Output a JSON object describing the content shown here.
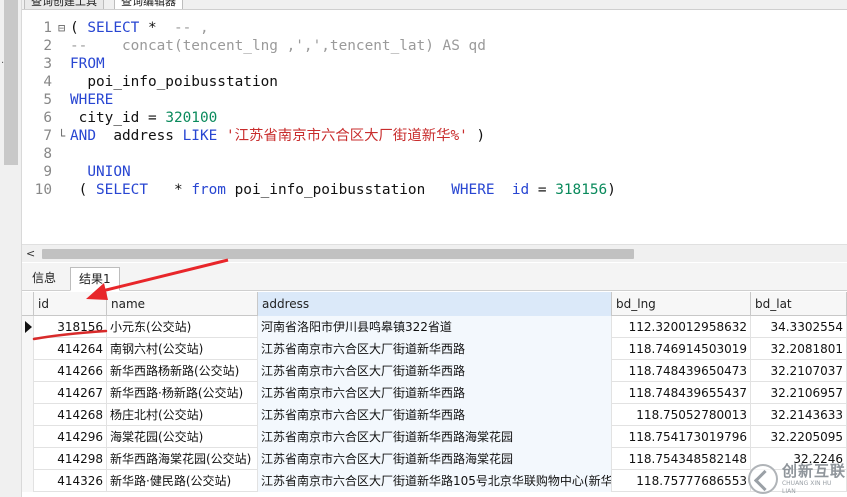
{
  "tabs": [
    "查询创建工具",
    "查询编辑器"
  ],
  "editor": {
    "lines": [
      {
        "n": "1",
        "fold": "⊟",
        "tokens": [
          [
            "txt",
            "( "
          ],
          [
            "kw",
            "SELECT"
          ],
          [
            "txt",
            " * "
          ],
          [
            "cmt",
            " -- ,"
          ]
        ]
      },
      {
        "n": "2",
        "fold": "",
        "tokens": [
          [
            "cmt",
            "--    concat(tencent_lng ,',',tencent_lat) AS qd"
          ]
        ]
      },
      {
        "n": "3",
        "fold": "",
        "tokens": [
          [
            "kw",
            "FROM"
          ]
        ]
      },
      {
        "n": "4",
        "fold": "",
        "tokens": [
          [
            "txt",
            "  poi_info_poibusstation"
          ]
        ]
      },
      {
        "n": "5",
        "fold": "",
        "tokens": [
          [
            "kw",
            "WHERE"
          ]
        ]
      },
      {
        "n": "6",
        "fold": "",
        "tokens": [
          [
            "txt",
            " city_id = "
          ],
          [
            "num",
            "320100"
          ]
        ]
      },
      {
        "n": "7",
        "fold": "└",
        "tokens": [
          [
            "kw",
            "AND"
          ],
          [
            "txt",
            "  address "
          ],
          [
            "kw",
            "LIKE"
          ],
          [
            "txt",
            " "
          ],
          [
            "str",
            "'江苏省南京市六合区大厂街道新华%'"
          ],
          [
            "txt",
            " )"
          ]
        ]
      },
      {
        "n": "8",
        "fold": "",
        "tokens": []
      },
      {
        "n": "9",
        "fold": "",
        "tokens": [
          [
            "txt",
            "  "
          ],
          [
            "kw",
            "UNION"
          ]
        ]
      },
      {
        "n": "10",
        "fold": "",
        "tokens": [
          [
            "txt",
            " ( "
          ],
          [
            "kw",
            "SELECT"
          ],
          [
            "txt",
            "   * "
          ],
          [
            "kw",
            "from"
          ],
          [
            "txt",
            " poi_info_poibusstation   "
          ],
          [
            "kw",
            "WHERE"
          ],
          [
            "txt",
            "  "
          ],
          [
            "kw",
            "id"
          ],
          [
            "txt",
            " = "
          ],
          [
            "num",
            "318156"
          ],
          [
            "txt",
            ")"
          ]
        ]
      }
    ]
  },
  "result_tabs": {
    "info": "信息",
    "result1": "结果1"
  },
  "grid": {
    "columns": [
      "id",
      "name",
      "address",
      "bd_lng",
      "bd_lat"
    ],
    "rows": [
      [
        "318156",
        "小元东(公交站)",
        "河南省洛阳市伊川县鸣皋镇322省道",
        "112.320012958632",
        "34.3302554"
      ],
      [
        "414264",
        "南钢六村(公交站)",
        "江苏省南京市六合区大厂街道新华西路",
        "118.746914503019",
        "32.2081801"
      ],
      [
        "414266",
        "新华西路杨新路(公交站)",
        "江苏省南京市六合区大厂街道新华西路",
        "118.748439650473",
        "32.2107037"
      ],
      [
        "414267",
        "新华西路·杨新路(公交站)",
        "江苏省南京市六合区大厂街道新华西路",
        "118.748439655437",
        "32.2106957"
      ],
      [
        "414268",
        "杨庄北村(公交站)",
        "江苏省南京市六合区大厂街道新华西路",
        "118.75052780013",
        "32.2143633"
      ],
      [
        "414296",
        "海棠花园(公交站)",
        "江苏省南京市六合区大厂街道新华西路海棠花园",
        "118.754173019796",
        "32.2205095"
      ],
      [
        "414298",
        "新华西路海棠花园(公交站)",
        "江苏省南京市六合区大厂街道新华西路海棠花园",
        "118.754348582148",
        "32.2246"
      ],
      [
        "414326",
        "新华路·健民路(公交站)",
        "江苏省南京市六合区大厂街道新华路105号北京华联购物中心(新华",
        "118.75777686553",
        ""
      ]
    ]
  },
  "watermark": {
    "cn": "创新互联",
    "en": "CHUANG XIN HU LIAN"
  }
}
